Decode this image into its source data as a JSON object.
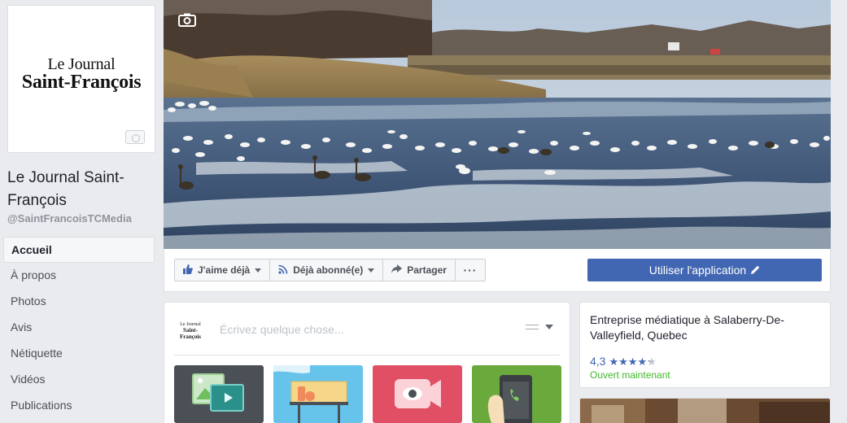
{
  "profile": {
    "logo_line1": "Le Journal",
    "logo_line2": "Saint-François",
    "name": "Le Journal Saint-François",
    "handle": "@SaintFrancoisTCMedia"
  },
  "nav": [
    {
      "label": "Accueil",
      "active": true
    },
    {
      "label": "À propos"
    },
    {
      "label": "Photos"
    },
    {
      "label": "Avis"
    },
    {
      "label": "Nétiquette"
    },
    {
      "label": "Vidéos"
    },
    {
      "label": "Publications"
    }
  ],
  "actions": {
    "like_label": "J'aime déjà",
    "follow_label": "Déjà abonné(e)",
    "share_label": "Partager",
    "more_label": "···",
    "cta_label": "Utiliser l'application"
  },
  "composer": {
    "logo_line1": "Le Journal",
    "logo_line2": "Saint-François",
    "placeholder": "Écrivez quelque chose..."
  },
  "about": {
    "title": "Entreprise médiatique à Salaberry-De-Valleyfield, Quebec",
    "rating": "4,3",
    "stars_filled": 4.3,
    "status": "Ouvert maintenant"
  },
  "colors": {
    "brand_blue": "#4267b2",
    "open_green": "#42b72a",
    "star_blue": "#4267b2"
  }
}
